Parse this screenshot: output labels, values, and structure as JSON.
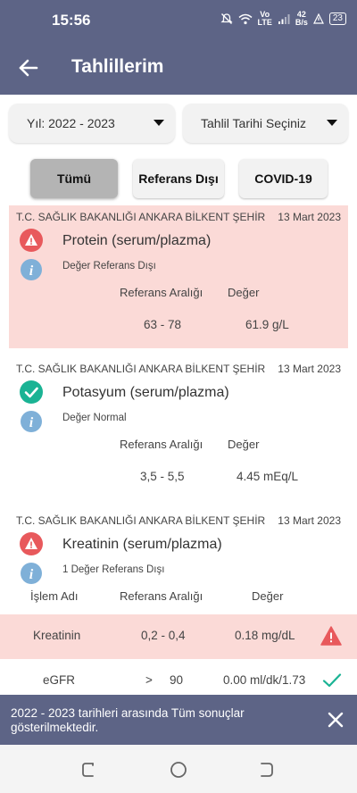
{
  "status_bar": {
    "time": "15:56",
    "net_type_top": "Vo",
    "net_type_bottom": "LTE",
    "speed_top": "42",
    "speed_bottom": "B/s",
    "battery": "23",
    "icons": [
      "mute-icon",
      "wifi-icon",
      "signal-icon",
      "alert-icon",
      "battery-icon"
    ]
  },
  "app_bar": {
    "title": "Tahlillerim",
    "back_icon": "arrow-left-icon"
  },
  "filters": {
    "year_label": "Yıl: 2022 - 2023",
    "date_label": "Tahlil Tarihi Seçiniz"
  },
  "tabs": [
    {
      "label": "Tümü",
      "selected": true
    },
    {
      "label": "Referans Dışı",
      "selected": false
    },
    {
      "label": "COVID-19",
      "selected": false
    }
  ],
  "results": [
    {
      "hospital": "T.C. SAĞLIK BAKANLIĞI ANKARA BİLKENT ŞEHİR",
      "date": "13 Mart 2023",
      "test": "Protein (serum/plazma)",
      "status_text": "Değer Referans Dışı",
      "status_icon": "warning-icon",
      "abnormal": true,
      "ref_header": "Referans Aralığı",
      "value_header": "Değer",
      "ref_range": "63 - 78",
      "value": "61.9 g/L"
    },
    {
      "hospital": "T.C. SAĞLIK BAKANLIĞI ANKARA BİLKENT ŞEHİR",
      "date": "13 Mart 2023",
      "test": "Potasyum (serum/plazma)",
      "status_text": "Değer Normal",
      "status_icon": "check-circle-icon",
      "abnormal": false,
      "ref_header": "Referans Aralığı",
      "value_header": "Değer",
      "ref_range": "3,5 - 5,5",
      "value": "4.45 mEq/L"
    },
    {
      "hospital": "T.C. SAĞLIK BAKANLIĞI ANKARA BİLKENT ŞEHİR",
      "date": "13 Mart 2023",
      "test": "Kreatinin (serum/plazma)",
      "status_text": "1 Değer Referans Dışı",
      "status_icon": "warning-icon",
      "abnormal": true,
      "name_header": "İşlem Adı",
      "ref_header": "Referans Aralığı",
      "value_header": "Değer",
      "rows": [
        {
          "name": "Kreatinin",
          "ref_range": "0,2 - 0,4",
          "value": "0.18 mg/dL",
          "abnormal": true
        },
        {
          "name": "eGFR",
          "ref_op": ">",
          "ref_range": "90",
          "value": "0.00 ml/dk/1.73",
          "abnormal": false
        }
      ]
    }
  ],
  "snackbar": {
    "message": "2022 - 2023 tarihleri arasında Tüm sonuçlar gösterilmektedir."
  },
  "colors": {
    "header": "#5d6486",
    "abnormal_bg": "#fbdad7",
    "warning": "#e8595c",
    "ok": "#1ab394",
    "info": "#7fb0d8"
  }
}
